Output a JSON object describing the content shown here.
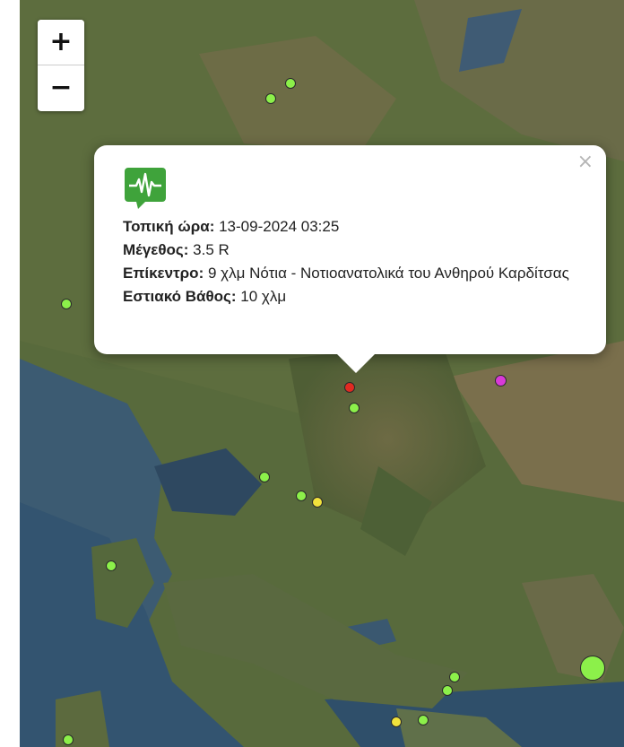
{
  "map": {
    "zoom_in_label": "+",
    "zoom_out_label": "−",
    "colors": {
      "green": "#8cf04a",
      "yellow": "#f1e23c",
      "red": "#e12a21",
      "magenta": "#d93ad7"
    }
  },
  "popup": {
    "close_label": "×",
    "icon": "seismograph-icon",
    "local_time_label": "Τοπική ώρα:",
    "local_time_value": "13-09-2024 03:25",
    "magnitude_label": "Μέγεθος:",
    "magnitude_value": "3.5 R",
    "epicenter_label": "Επίκεντρο:",
    "epicenter_value": "9 χλμ Νότια - Νοτιοανατολικά του Ανθηρού Καρδίτσας",
    "depth_label": "Εστιακό Βάθος:",
    "depth_value": "10 χλμ"
  }
}
